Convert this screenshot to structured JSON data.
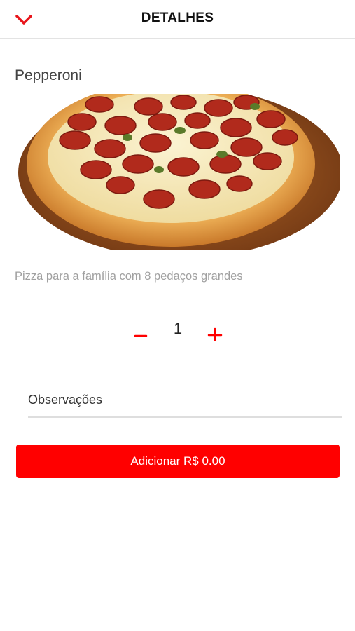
{
  "header": {
    "title": "DETALHES",
    "back_icon": "chevron-down-icon"
  },
  "product": {
    "name": "Pepperoni",
    "image_icon": "pizza-image",
    "description": "Pizza para a família com 8 pedaços grandes"
  },
  "quantity": {
    "decrease_icon": "minus-icon",
    "value": "1",
    "increase_icon": "plus-icon"
  },
  "notes": {
    "placeholder": "Observações",
    "value": ""
  },
  "add_button": {
    "label": "Adicionar R$ 0.00"
  },
  "colors": {
    "accent": "#ff0000",
    "divider": "#e3e3e3",
    "muted_text": "#a0a0a0"
  }
}
